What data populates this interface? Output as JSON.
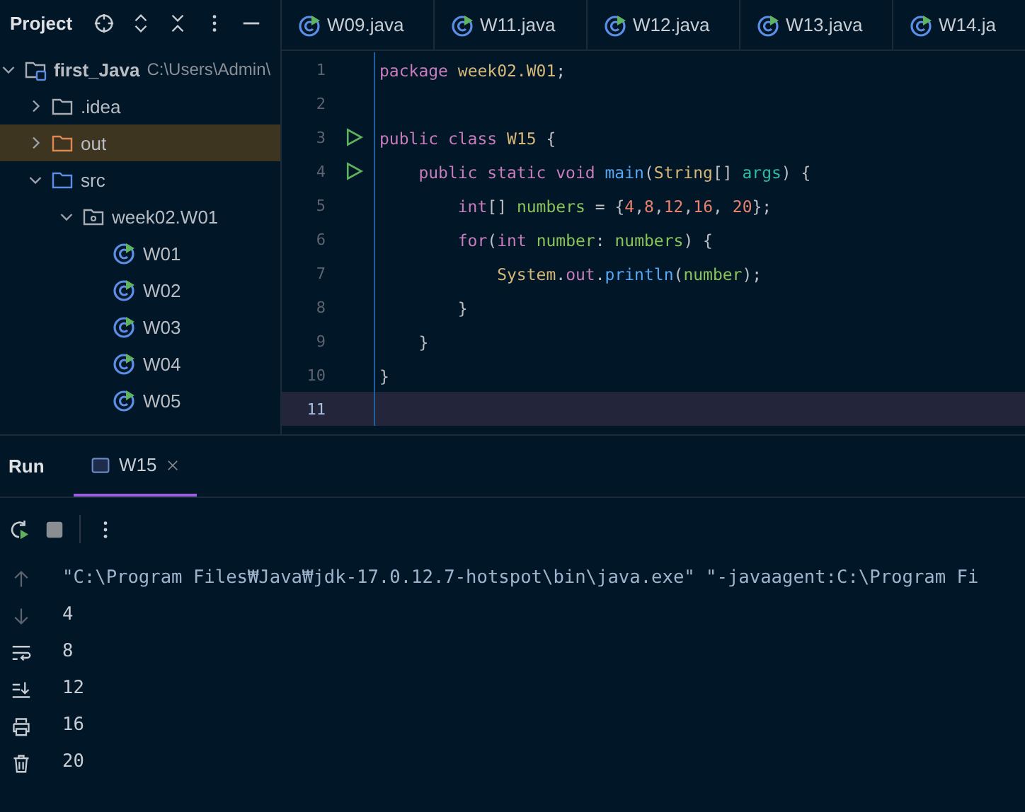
{
  "project_panel": {
    "title": "Project",
    "tree": [
      {
        "label": "first_Java",
        "path": "C:\\Users\\Admin\\",
        "kind": "project",
        "expanded": true,
        "selected": false,
        "children": [
          {
            "label": ".idea",
            "kind": "folder",
            "expanded": false,
            "selected": false
          },
          {
            "label": "out",
            "kind": "excluded",
            "expanded": false,
            "selected": true
          },
          {
            "label": "src",
            "kind": "source",
            "expanded": true,
            "selected": false,
            "children": [
              {
                "label": "week02.W01",
                "kind": "package",
                "expanded": true,
                "selected": false,
                "children": [
                  {
                    "label": "W01",
                    "kind": "class",
                    "selected": false
                  },
                  {
                    "label": "W02",
                    "kind": "class",
                    "selected": false
                  },
                  {
                    "label": "W03",
                    "kind": "class",
                    "selected": false
                  },
                  {
                    "label": "W04",
                    "kind": "class",
                    "selected": false
                  },
                  {
                    "label": "W05",
                    "kind": "class",
                    "selected": false
                  }
                ]
              }
            ]
          }
        ]
      }
    ]
  },
  "editor_tabs": [
    {
      "label": "W09.java",
      "selected": false
    },
    {
      "label": "W11.java",
      "selected": false
    },
    {
      "label": "W12.java",
      "selected": false
    },
    {
      "label": "W13.java",
      "selected": false
    },
    {
      "label": "W14.ja",
      "selected": false
    }
  ],
  "editor": {
    "lines": [
      {
        "number": "1",
        "run": false,
        "current": false,
        "tokens": [
          {
            "text": "package ",
            "kind": "keyword"
          },
          {
            "text": "week02.W01",
            "kind": "type"
          },
          {
            "text": ";",
            "kind": "plain"
          }
        ]
      },
      {
        "number": "2",
        "run": false,
        "current": false
      },
      {
        "number": "3",
        "run": true,
        "current": false,
        "tokens": [
          {
            "text": "public class ",
            "kind": "keyword"
          },
          {
            "text": "W15",
            "kind": "type"
          },
          {
            "text": " {",
            "kind": "plain"
          }
        ]
      },
      {
        "number": "4",
        "run": true,
        "current": false,
        "tokens": [
          {
            "text": "    public static void ",
            "kind": "keyword"
          },
          {
            "text": "main",
            "kind": "method"
          },
          {
            "text": "(",
            "kind": "plain"
          },
          {
            "text": "String",
            "kind": "type"
          },
          {
            "text": "[] ",
            "kind": "plain"
          },
          {
            "text": "args",
            "kind": "param"
          },
          {
            "text": ") {",
            "kind": "plain"
          }
        ]
      },
      {
        "number": "5",
        "run": false,
        "current": false,
        "tokens": [
          {
            "text": "        int",
            "kind": "keyword"
          },
          {
            "text": "[] ",
            "kind": "plain"
          },
          {
            "text": "numbers",
            "kind": "var"
          },
          {
            "text": " = {",
            "kind": "plain"
          },
          {
            "text": "4",
            "kind": "number"
          },
          {
            "text": ",",
            "kind": "plain"
          },
          {
            "text": "8",
            "kind": "number"
          },
          {
            "text": ",",
            "kind": "plain"
          },
          {
            "text": "12",
            "kind": "number"
          },
          {
            "text": ",",
            "kind": "plain"
          },
          {
            "text": "16",
            "kind": "number"
          },
          {
            "text": ", ",
            "kind": "plain"
          },
          {
            "text": "20",
            "kind": "number"
          },
          {
            "text": "};",
            "kind": "plain"
          }
        ]
      },
      {
        "number": "6",
        "run": false,
        "current": false,
        "tokens": [
          {
            "text": "        for",
            "kind": "keyword"
          },
          {
            "text": "(",
            "kind": "plain"
          },
          {
            "text": "int ",
            "kind": "keyword"
          },
          {
            "text": "number",
            "kind": "var"
          },
          {
            "text": ": ",
            "kind": "plain"
          },
          {
            "text": "numbers",
            "kind": "var"
          },
          {
            "text": ") {",
            "kind": "plain"
          }
        ]
      },
      {
        "number": "7",
        "run": false,
        "current": false,
        "tokens": [
          {
            "text": "            System",
            "kind": "type"
          },
          {
            "text": ".",
            "kind": "plain"
          },
          {
            "text": "out",
            "kind": "field"
          },
          {
            "text": ".",
            "kind": "plain"
          },
          {
            "text": "println",
            "kind": "method"
          },
          {
            "text": "(",
            "kind": "plain"
          },
          {
            "text": "number",
            "kind": "var"
          },
          {
            "text": ");",
            "kind": "plain"
          }
        ]
      },
      {
        "number": "8",
        "run": false,
        "current": false,
        "tokens": [
          {
            "text": "        }",
            "kind": "plain"
          }
        ]
      },
      {
        "number": "9",
        "run": false,
        "current": false,
        "tokens": [
          {
            "text": "    }",
            "kind": "plain"
          }
        ]
      },
      {
        "number": "10",
        "run": false,
        "current": false,
        "tokens": [
          {
            "text": "}",
            "kind": "plain"
          }
        ]
      },
      {
        "number": "11",
        "run": false,
        "current": true
      }
    ]
  },
  "run_panel": {
    "title": "Run",
    "tabs": [
      {
        "label": "W15",
        "selected": true
      }
    ],
    "output": [
      "\"C:\\Program Files₩Java₩jdk-17.0.12.7-hotspot\\bin\\java.exe\" \"-javaagent:C:\\Program Fi",
      "4",
      "8",
      "12",
      "16",
      "20"
    ]
  }
}
